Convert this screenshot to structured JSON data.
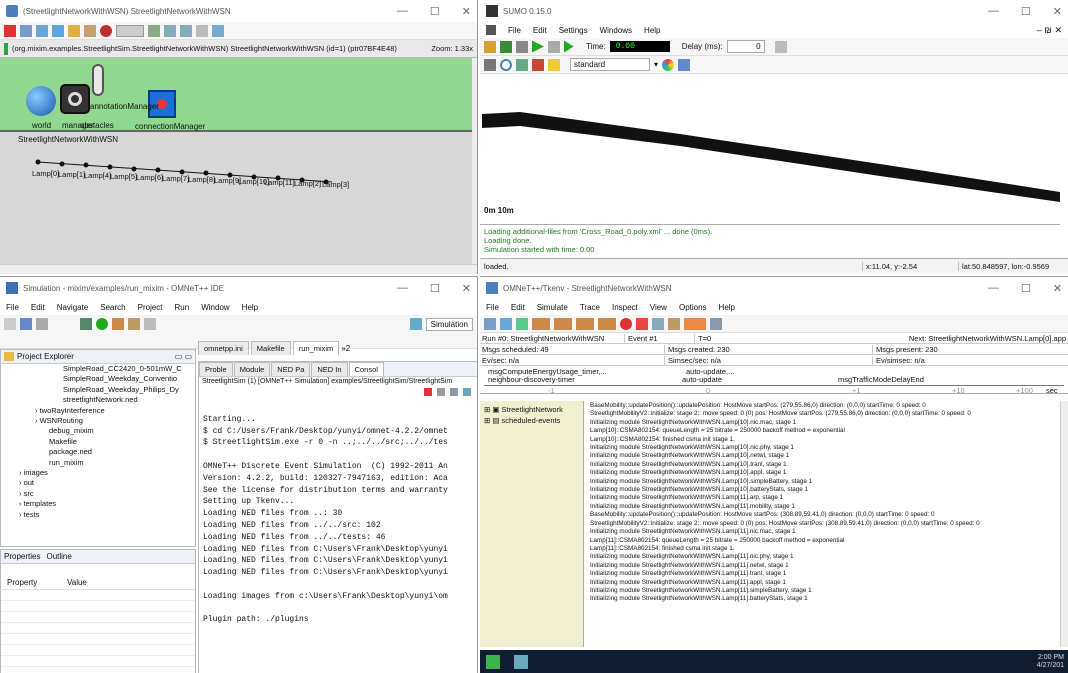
{
  "win1": {
    "title": "(StreetlightNetworkWithWSN) StreetlightNetworkWithWSN",
    "path": "(org.mixim.examples.StreetlightSim.StreetlightNetworkWithWSN) StreetlightNetworkWithWSN (id=1) (ptr07BF4E48)",
    "zoom": "Zoom: 1.33x",
    "submodules": [
      "world",
      "manager",
      "obstacles",
      "connectionManager"
    ],
    "annotationManager": "annotationManager",
    "network_label": "StreetlightNetworkWithWSN",
    "lamps": [
      "Lamp[0]",
      "Lamp[1]",
      "Lamp[4]",
      "Lamp[5]",
      "Lamp[6]",
      "Lamp[7]",
      "Lamp[8]",
      "Lamp[9]",
      "Lamp[10]",
      "Lamp[11]",
      "Lamp[2]",
      "Lamp[3]"
    ]
  },
  "sumo": {
    "title": "SUMO 0.15.0",
    "menu": [
      "File",
      "Edit",
      "Settings",
      "Windows",
      "Help"
    ],
    "time_label": "Time:",
    "time_value": "0.00",
    "delay_label": "Delay (ms):",
    "delay_value": "0",
    "scheme": "standard",
    "scale": "0m 10m",
    "log": [
      "Loading additional-files from 'Cross_Road_0.poly.xml' ... done (0ms).",
      "Loading done.",
      "Simulation started with time: 0.00"
    ],
    "status": "loaded.",
    "coords": "x:11.04, y:-2.54",
    "latlon": "lat:50.848597, lon:-0.9569"
  },
  "ide": {
    "title": "Simulation - mixim/examples/run_mixim - OMNeT++ IDE",
    "menu": [
      "File",
      "Edit",
      "Navigate",
      "Search",
      "Project",
      "Run",
      "Window",
      "Help"
    ],
    "perspective": "Simulation",
    "explorer_tab": "Project Explorer",
    "tree": [
      "SimpleRoad_CC2420_0-501mW_C",
      "SimpleRoad_Weekday_Conventio",
      "SimpleRoad_Weekday_Philips_Dy",
      "streetlightNetwork.ned",
      "twoRayInterference",
      "WSNRouting",
      "debug_mixim",
      "Makefile",
      "package.ned",
      "run_mixim",
      "images",
      "out",
      "src",
      "templates",
      "tests"
    ],
    "props_tab": "Properties",
    "outline_tab": "Outline",
    "prop_cols": [
      "Property",
      "Value"
    ],
    "editor_tabs": [
      "omnetpp.ini",
      "Makefile",
      "run_mixim"
    ],
    "editor_more": "»2",
    "view_tabs": [
      "Proble",
      "Module",
      "NED Pa",
      "NED In",
      "Consol"
    ],
    "console_title": "StreetlightSim (1) [OMNeT++ Simulation] examples/StreetlightSim/StreetlightSim",
    "console": [
      "Starting...",
      "",
      "$ cd C:/Users/Frank/Desktop/yunyi/omnet-4.2.2/omnet",
      "$ StreetlightSim.exe -r 0 -n ..;../../src;../../tes",
      "",
      "OMNeT++ Discrete Event Simulation  (C) 1992-2011 An",
      "Version: 4.2.2, build: 120327-7947163, edition: Aca",
      "See the license for distribution terms and warranty",
      "Setting up Tkenv...",
      "Loading NED files from ..: 30",
      "Loading NED files from ../../src: 102",
      "Loading NED files from ../../tests: 46",
      "Loading NED files from C:\\Users\\Frank\\Desktop\\yunyi",
      "Loading NED files from C:\\Users\\Frank\\Desktop\\yunyi",
      "Loading NED files from C:\\Users\\Frank\\Desktop\\yunyi",
      "",
      "Loading images from c:\\Users\\Frank\\Desktop\\yunyi\\om",
      "",
      "Plugin path: ./plugins"
    ]
  },
  "tkenv": {
    "title": "OMNeT++/Tkenv - StreetlightNetworkWithWSN",
    "menu": [
      "File",
      "Edit",
      "Simulate",
      "Trace",
      "Inspect",
      "View",
      "Options",
      "Help"
    ],
    "run": "Run #0: StreetlightNetworkWithWSN",
    "event": "Event #1",
    "t": "T=0",
    "next": "Next: StreetlightNetworkWithWSN.Lamp[0].app",
    "scheduled": "Msgs scheduled: 49",
    "created": "Msgs created: 230",
    "present": "Msgs present: 230",
    "evsec": "Ev/sec: n/a",
    "simsec": "Simsec/sec: n/a",
    "evsimsec": "Ev/simsec: n/a",
    "timeline": [
      "msgComputeEnergyUsage_timer,...",
      "neighbour-discovery-timer",
      "auto-update,...",
      "auto-update",
      "msgTrafficModeDelayEnd"
    ],
    "ticks": [
      "-1",
      "0",
      "+1",
      "+10",
      "+100",
      "sec"
    ],
    "tree": [
      "StreetlightNetwork",
      "scheduled-events"
    ],
    "log": [
      "BaseMobility::updatePosition()::updatePosition: HostMove startPos: (279,55.86,0) direction: (0,0,0) startTime: 0 speed: 0",
      "StreetlightMobilityV2::initialize: stage 2:: move speed: 0 (0) pos: HostMove startPos: (279,55.86,0) direction: (0,0,0) startTime: 0 speed: 0",
      "Initializing module StreetlightNetworkWithWSN.Lamp[10].nic.mac, stage 1",
      "Lamp[10]::CSMA802154: queueLength = 25 bitrate = 250000 backoff method = exponential",
      "Lamp[10]::CSMA802154: finished csma init stage 1.",
      "Initializing module StreetlightNetworkWithWSN.Lamp[10].nic.phy, stage 1",
      "Initializing module StreetlightNetworkWithWSN.Lamp[10].netwl, stage 1",
      "Initializing module StreetlightNetworkWithWSN.Lamp[10].tranl, stage 1",
      "Initializing module StreetlightNetworkWithWSN.Lamp[10].appl, stage 1",
      "Initializing module StreetlightNetworkWithWSN.Lamp[10].simpleBattery, stage 1",
      "Initializing module StreetlightNetworkWithWSN.Lamp[10].batteryStats, stage 1",
      "Initializing module StreetlightNetworkWithWSN.Lamp[11].arp, stage 1",
      "Initializing module StreetlightNetworkWithWSN.Lamp[11].mobility, stage 1",
      "BaseMobility::updatePosition()::updatePosition: HostMove startPos: (308.89,59.41,0) direction: (0,0,0) startTime: 0 speed: 0",
      "StreetlightMobilityV2::initialize: stage 2:: move speed: 0 (0) pos: HostMove startPos: (308.89,59.41,0) direction: (0,0,0) startTime: 0 speed: 0",
      "Initializing module StreetlightNetworkWithWSN.Lamp[11].nic.mac, stage 1",
      "Lamp[11]::CSMA802154: queueLength = 25 bitrate = 250000 backoff method = exponential",
      "Lamp[11]::CSMA802154: finished csma init stage 1.",
      "Initializing module StreetlightNetworkWithWSN.Lamp[11].nic.phy, stage 1",
      "Initializing module StreetlightNetworkWithWSN.Lamp[11].netwl, stage 1",
      "Initializing module StreetlightNetworkWithWSN.Lamp[11].tranl, stage 1",
      "Initializing module StreetlightNetworkWithWSN.Lamp[11].appl, stage 1",
      "Initializing module StreetlightNetworkWithWSN.Lamp[11].simpleBattery, stage 1",
      "Initializing module StreetlightNetworkWithWSN.Lamp[11].batteryStats, stage 1"
    ]
  },
  "taskbar": {
    "time": "2:00 PM",
    "date": "4/27/201"
  },
  "colors": {
    "green": "#90d890",
    "gray": "#d7d7d7",
    "sumo_log": "#1f7a1f",
    "tk_panel": "#f0f0d0"
  }
}
